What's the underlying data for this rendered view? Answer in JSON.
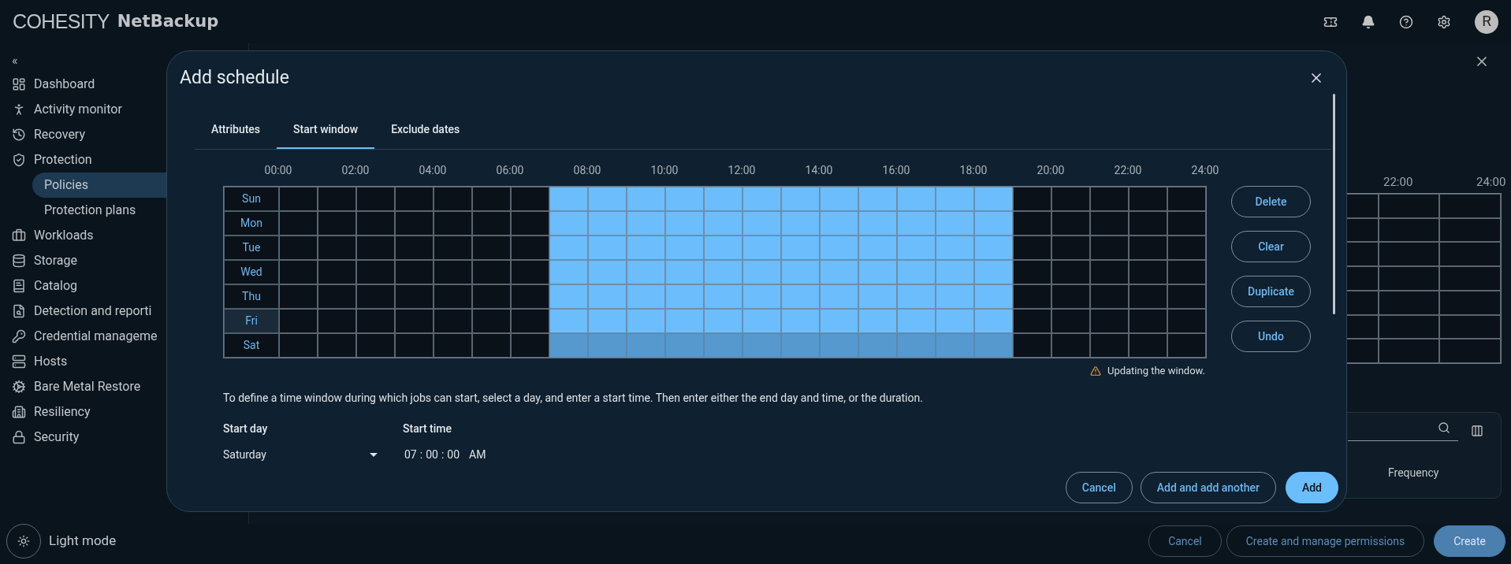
{
  "header": {
    "logo": "COHESITY",
    "product": "NetBackup",
    "avatar": "R"
  },
  "sidebar": {
    "collapse": "«",
    "items": [
      {
        "label": "Dashboard",
        "selected": false
      },
      {
        "label": "Activity monitor",
        "selected": false
      },
      {
        "label": "Recovery",
        "selected": false
      },
      {
        "label": "Protection",
        "selected": false,
        "expanded": true,
        "children": [
          {
            "label": "Policies",
            "selected": true
          },
          {
            "label": "Protection plans",
            "selected": false
          }
        ]
      },
      {
        "label": "Workloads",
        "selected": false
      },
      {
        "label": "Storage",
        "selected": false
      },
      {
        "label": "Catalog",
        "selected": false
      },
      {
        "label": "Detection and reporti",
        "selected": false
      },
      {
        "label": "Credential manageme",
        "selected": false
      },
      {
        "label": "Hosts",
        "selected": false
      },
      {
        "label": "Bare Metal Restore",
        "selected": false
      },
      {
        "label": "Resiliency",
        "selected": false
      },
      {
        "label": "Security",
        "selected": false
      }
    ],
    "theme_toggle": "Light mode"
  },
  "background": {
    "grid_hours": [
      "22:00",
      "24:00"
    ],
    "table": {
      "columns": [
        "Frequency"
      ]
    },
    "buttons": [
      {
        "label": "Cancel",
        "kind": "outline"
      },
      {
        "label": "Create and manage permissions",
        "kind": "outline"
      },
      {
        "label": "Create",
        "kind": "filled"
      }
    ]
  },
  "dialog": {
    "title": "Add schedule",
    "tabs": [
      {
        "label": "Attributes",
        "selected": false
      },
      {
        "label": "Start window",
        "selected": true
      },
      {
        "label": "Exclude dates",
        "selected": false
      }
    ],
    "hours": [
      "00:00",
      "02:00",
      "04:00",
      "06:00",
      "08:00",
      "10:00",
      "12:00",
      "14:00",
      "16:00",
      "18:00",
      "20:00",
      "22:00",
      "24:00"
    ],
    "days": [
      {
        "label": "Sun",
        "selected": false,
        "highlighted": false,
        "cells": [
          false,
          false,
          false,
          false,
          false,
          false,
          false,
          true,
          true,
          true,
          true,
          true,
          true,
          true,
          true,
          true,
          true,
          true,
          true,
          false,
          false,
          false,
          false,
          false
        ]
      },
      {
        "label": "Mon",
        "selected": false,
        "highlighted": false,
        "cells": [
          false,
          false,
          false,
          false,
          false,
          false,
          false,
          true,
          true,
          true,
          true,
          true,
          true,
          true,
          true,
          true,
          true,
          true,
          true,
          false,
          false,
          false,
          false,
          false
        ]
      },
      {
        "label": "Tue",
        "selected": false,
        "highlighted": false,
        "cells": [
          false,
          false,
          false,
          false,
          false,
          false,
          false,
          true,
          true,
          true,
          true,
          true,
          true,
          true,
          true,
          true,
          true,
          true,
          true,
          false,
          false,
          false,
          false,
          false
        ]
      },
      {
        "label": "Wed",
        "selected": false,
        "highlighted": false,
        "cells": [
          false,
          false,
          false,
          false,
          false,
          false,
          false,
          true,
          true,
          true,
          true,
          true,
          true,
          true,
          true,
          true,
          true,
          true,
          true,
          false,
          false,
          false,
          false,
          false
        ]
      },
      {
        "label": "Thu",
        "selected": false,
        "highlighted": false,
        "cells": [
          false,
          false,
          false,
          false,
          false,
          false,
          false,
          true,
          true,
          true,
          true,
          true,
          true,
          true,
          true,
          true,
          true,
          true,
          true,
          false,
          false,
          false,
          false,
          false
        ]
      },
      {
        "label": "Fri",
        "selected": false,
        "highlighted": true,
        "cells": [
          false,
          false,
          false,
          false,
          false,
          false,
          false,
          true,
          true,
          true,
          true,
          true,
          true,
          true,
          true,
          true,
          true,
          true,
          true,
          false,
          false,
          false,
          false,
          false
        ]
      },
      {
        "label": "Sat",
        "selected": true,
        "highlighted": false,
        "cells": [
          false,
          false,
          false,
          false,
          false,
          false,
          false,
          true,
          true,
          true,
          true,
          true,
          true,
          true,
          true,
          true,
          true,
          true,
          true,
          false,
          false,
          false,
          false,
          false
        ]
      }
    ],
    "side_buttons": [
      "Delete",
      "Clear",
      "Duplicate",
      "Undo"
    ],
    "warning": "Updating the window.",
    "instructions": "To define a time window during which jobs can start, select a day, and enter a start time. Then enter either the end day and time, or the duration.",
    "start_day": {
      "label": "Start day",
      "value": "Saturday"
    },
    "start_time": {
      "label": "Start time",
      "hours": "07",
      "minutes": "00",
      "seconds": "00",
      "period": "AM",
      "separator": ":"
    },
    "footer": [
      {
        "label": "Cancel",
        "kind": "outline"
      },
      {
        "label": "Add and add another",
        "kind": "outline"
      },
      {
        "label": "Add",
        "kind": "filled"
      }
    ]
  }
}
